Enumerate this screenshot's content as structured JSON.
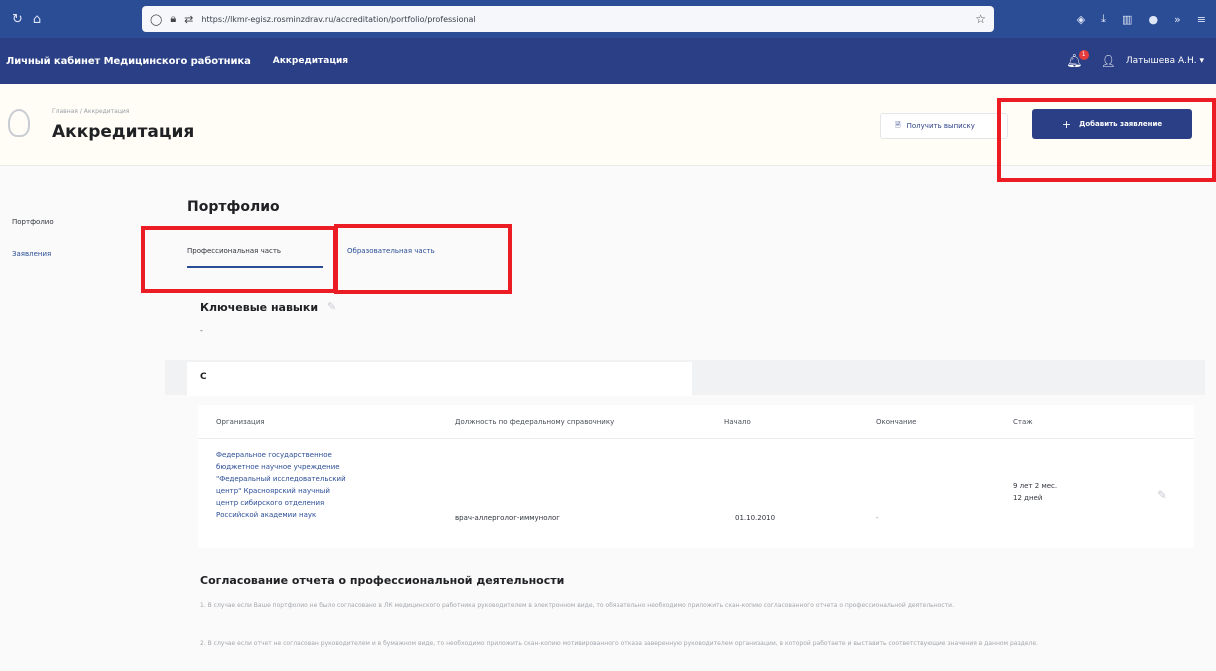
{
  "browser": {
    "url": "https://lkmr-egisz.rosminzdrav.ru/accreditation/portfolio/professional"
  },
  "header": {
    "app_title": "Личный кабинет Медицинского работника",
    "nav_accreditation": "Аккредитация",
    "notification_count": "1",
    "user_name": "Латышева А.Н. ▾"
  },
  "page": {
    "breadcrumb": "Главная / Аккредитация",
    "title": "Аккредитация",
    "get_extract_label": "Получить выписку",
    "add_application_label": "Добавить заявление"
  },
  "sidebar": {
    "items": [
      {
        "label": "Портфолио"
      },
      {
        "label": "Заявления"
      }
    ]
  },
  "main": {
    "section_title": "Портфолио",
    "tabs": [
      {
        "label": "Профессиональная часть",
        "active": true
      },
      {
        "label": "Образовательная часть",
        "active": false
      }
    ],
    "skills_title": "Ключевые навыки",
    "skills_value": "-",
    "work_heading_letter": "С"
  },
  "table": {
    "headers": [
      "Организация",
      "Должность по федеральному справочнику",
      "Начало",
      "Окончание",
      "Стаж"
    ],
    "rows": [
      {
        "org": "Федеральное государственное бюджетное научное учреждение \"Федеральный исследовательский центр\" Красноярский научный центр сибирского отделения Российской академии наук",
        "position": "врач-аллерголог-иммунолог",
        "start": "01.10.2010",
        "end": "-",
        "experience": "9 лет 2 мес. 12 дней"
      }
    ]
  },
  "agreement": {
    "title": "Согласование отчета о профессиональной деятельности",
    "p1": "1. В случае если Ваше портфолио не было согласовано в ЛК медицинского работника руководителем в электронном виде, то обязательно необходимо приложить скан-копию согласованного отчета о профессиональной деятельности.",
    "p2": "2. В случае если отчет не согласован руководителем и в бумажном виде, то необходимо приложить скан-копию мотивированного отказа заверенную руководителем организации, в которой работаете и выставить соответствующие значения в данном разделе."
  },
  "colors": {
    "header_blue": "#2a3f86",
    "browser_blue": "#2a4d96",
    "highlight_red": "#ec1c24",
    "link_blue": "#2a4d96"
  }
}
